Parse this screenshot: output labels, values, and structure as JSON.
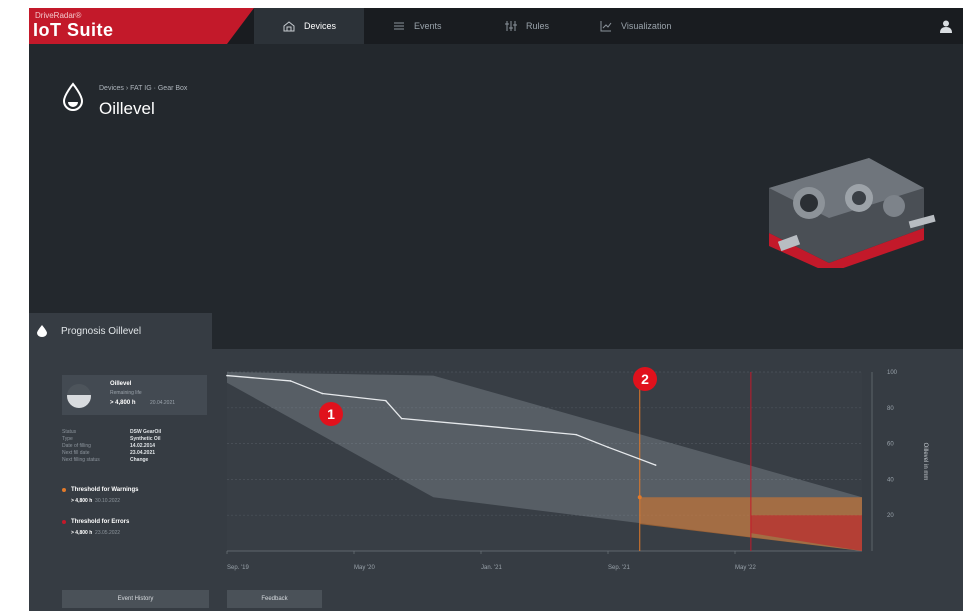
{
  "brand": {
    "superscript": "DriveRadar®",
    "name": "IoT Suite"
  },
  "nav": {
    "tabs": [
      {
        "label": "Devices",
        "icon": "devices-icon",
        "active": true
      },
      {
        "label": "Events",
        "icon": "events-icon",
        "active": false
      },
      {
        "label": "Rules",
        "icon": "rules-icon",
        "active": false
      },
      {
        "label": "Visualization",
        "icon": "visualization-icon",
        "active": false
      }
    ],
    "user_icon": "user-icon"
  },
  "header": {
    "breadcrumb": "Devices › FAT IG · Gear Box",
    "title": "Oillevel"
  },
  "prognosis": {
    "tab_label": "Prognosis Oillevel",
    "card": {
      "title": "Oillevel",
      "subtitle": "Remaining life",
      "value": "> 4,800 h",
      "date": "20.04.2021"
    },
    "properties": [
      {
        "key": "Status",
        "value": "DSW GearOil"
      },
      {
        "key": "Type",
        "value": "Synthetic Oil"
      },
      {
        "key": "Date of filling",
        "value": "14.02.2014"
      },
      {
        "key": "Next fill date",
        "value": "23.04.2021"
      },
      {
        "key": "Next filling status",
        "value": "Change"
      }
    ],
    "thresholds": [
      {
        "label": "Threshold for Warnings",
        "value": "> 4,800 h",
        "date": "30.10.2022",
        "color": "#e27a2a"
      },
      {
        "label": "Threshold for Errors",
        "value": "> 4,800 h",
        "date": "23.05.2022",
        "color": "#c3192a"
      }
    ],
    "buttons": {
      "history": "Event History",
      "feedback": "Feedback"
    },
    "markers": [
      "1",
      "2"
    ]
  },
  "colors": {
    "accent": "#c3192a",
    "warning": "#e27a2a",
    "background": "#23282d",
    "panel": "#363c43"
  },
  "chart_data": {
    "type": "area",
    "title": "",
    "xlabel": "",
    "ylabel": "Oillevel in mm",
    "x_ticks": [
      "Sep. '19",
      "May '20",
      "Jan. '21",
      "Sep. '21",
      "May '22"
    ],
    "y_ticks": [
      "100",
      "80",
      "60",
      "40",
      "20"
    ],
    "ylim": [
      0,
      100
    ],
    "series": [
      {
        "name": "",
        "x": [
          "Sep. '19",
          "Jan. '20",
          "Mar. '20",
          "Jul. '20",
          "Aug. '20",
          "Jan. '21",
          "Jul. '21",
          "Sep. '21",
          "Dec. '21"
        ],
        "values": [
          98,
          95,
          88,
          84,
          74,
          70,
          65,
          58,
          48
        ]
      }
    ],
    "prognosis_band": {
      "upper": [
        100,
        98,
        30
      ],
      "lower": [
        94,
        30,
        0
      ]
    },
    "threshold_lines": [
      {
        "x": "Nov. '21",
        "color": "#e27a2a"
      },
      {
        "x": "Jun. '22",
        "color": "#c3192a"
      }
    ],
    "grid": true
  }
}
